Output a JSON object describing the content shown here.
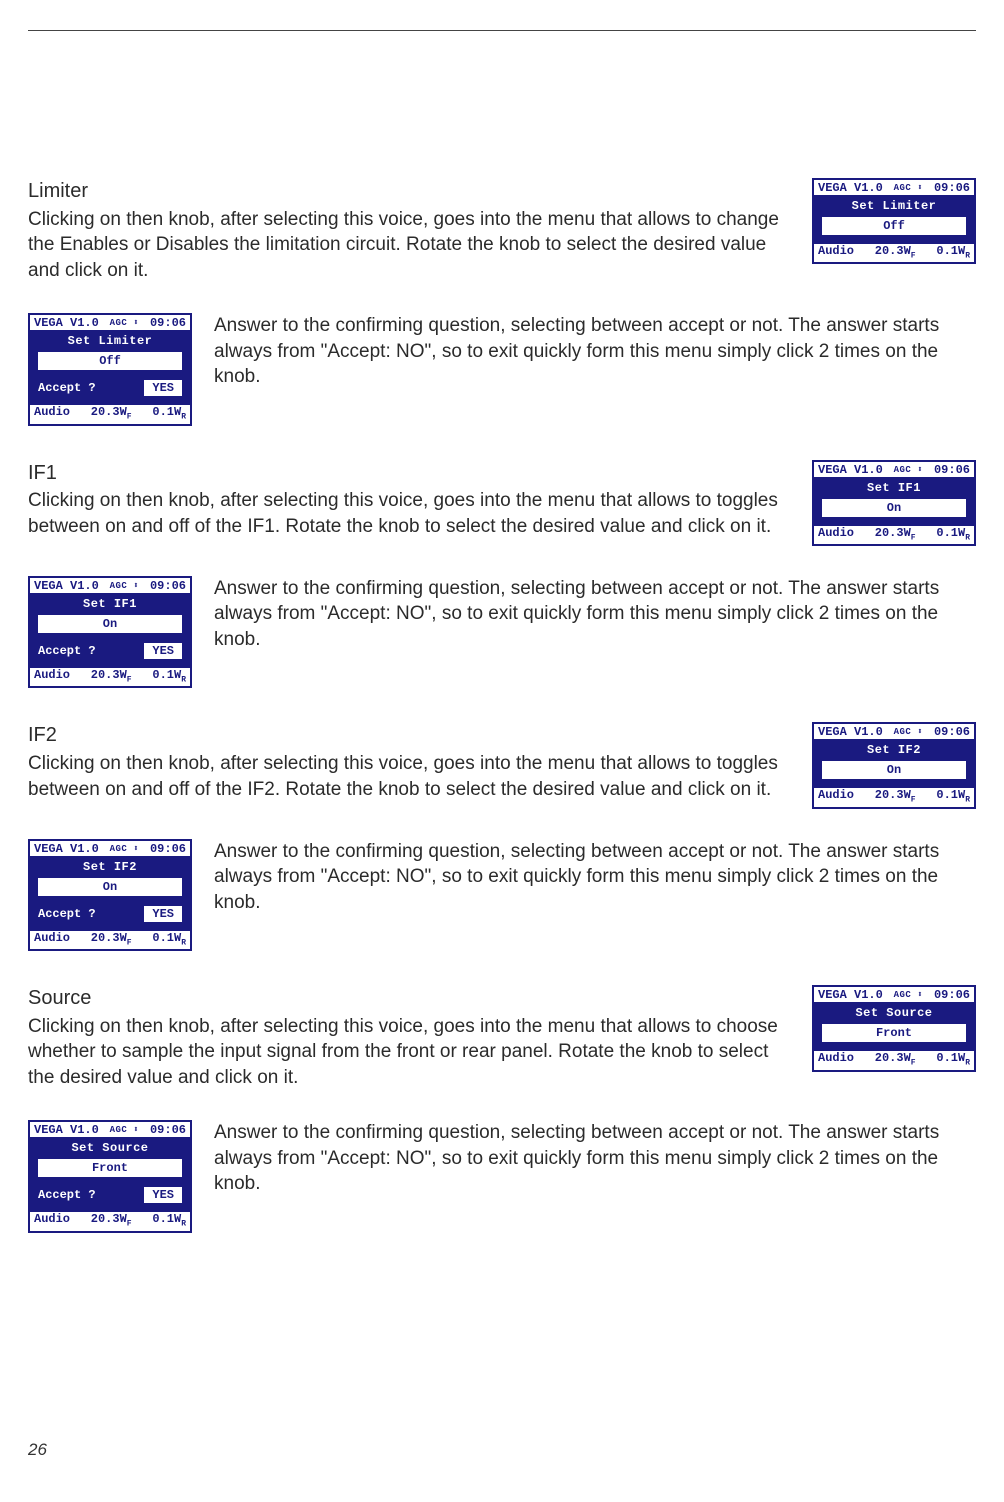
{
  "page_number": "26",
  "confirm_text": "Answer to the confirming question, selecting between accept or not. The answer starts always from \"Accept: NO\", so to exit quickly form this menu simply click 2 times on the knob.",
  "lcd_common": {
    "version": "VEGA V1.0",
    "agc": "AGC ⬍",
    "time": "09:06",
    "audio_label": "Audio",
    "wf": "20.3W",
    "wf_sub": "F",
    "wr": "0.1W",
    "wr_sub": "R",
    "accept_label": "Accept ?",
    "yes_label": "YES"
  },
  "sections": [
    {
      "heading": "Limiter",
      "body": "Clicking on then knob, after selecting this voice, goes into the menu that allows to change the Enables or Disables the limitation circuit. Rotate the knob to select the desired value and click on it.",
      "lcd_title": "Set Limiter",
      "lcd_value": "Off",
      "confirm_value": "Off"
    },
    {
      "heading": "IF1",
      "body": "Clicking on then knob, after selecting this voice, goes into the menu that allows to toggles between on and off of the IF1. Rotate the knob to select the desired value and click on it.",
      "lcd_title": "Set IF1",
      "lcd_value": "On",
      "confirm_value": "On"
    },
    {
      "heading": "IF2",
      "body": "Clicking on then knob, after selecting this voice, goes into the menu that allows to toggles between on and off of the IF2. Rotate the knob to select the desired value and click on it.",
      "lcd_title": "Set IF2",
      "lcd_value": "On",
      "confirm_value": "On"
    },
    {
      "heading": "Source",
      "body": "Clicking on then knob, after selecting this voice, goes into the menu that allows to choose whether to sample the input signal from the front or rear panel. Rotate the knob to select the desired value and click on it.",
      "lcd_title": "Set Source",
      "lcd_value": "Front",
      "confirm_value": "Front"
    }
  ]
}
